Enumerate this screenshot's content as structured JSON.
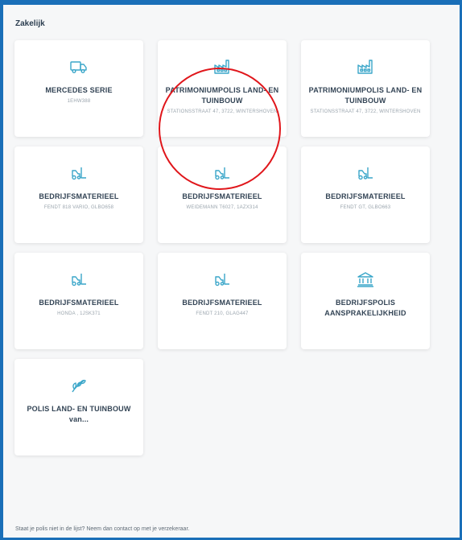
{
  "section": {
    "title": "Zakelijk"
  },
  "colors": {
    "accent": "#1a6fb8",
    "icon": "#3aa6c9",
    "highlight": "#e0161b"
  },
  "cards": [
    {
      "icon": "truck-icon",
      "title": "MERCEDES SERIE",
      "subtitle": "1EHW388"
    },
    {
      "icon": "factory-icon",
      "title": "PATRIMONIUMPOLIS LAND- EN TUINBOUW",
      "subtitle": "STATIONSSTRAAT 47, 3722, WINTERSHOVEN"
    },
    {
      "icon": "factory-icon",
      "title": "PATRIMONIUMPOLIS LAND- EN TUINBOUW",
      "subtitle": "STATIONSSTRAAT 47, 3722, WINTERSHOVEN"
    },
    {
      "icon": "forklift-icon",
      "title": "BEDRIJFSMATERIEEL",
      "subtitle": "FENDT 818 VARIO, GLBO658"
    },
    {
      "icon": "forklift-icon",
      "title": "BEDRIJFSMATERIEEL",
      "subtitle": "WEIDEMANN T6027, 1AZX314"
    },
    {
      "icon": "forklift-icon",
      "title": "BEDRIJFSMATERIEEL",
      "subtitle": "FENDT GT, GLBO663"
    },
    {
      "icon": "forklift-icon",
      "title": "BEDRIJFSMATERIEEL",
      "subtitle": "HONDA , 1JSK371"
    },
    {
      "icon": "forklift-icon",
      "title": "BEDRIJFSMATERIEEL",
      "subtitle": "FENDT 210, GLAG447"
    },
    {
      "icon": "bank-icon",
      "title": "BEDRIJFSPOLIS AANSPRAKELIJKHEID",
      "subtitle": ""
    },
    {
      "icon": "leaf-icon",
      "title": "POLIS LAND- EN TUINBOUW van...",
      "subtitle": ""
    }
  ],
  "footer": {
    "note": "Staat je polis niet in de lijst? Neem dan contact op met je verzekeraar."
  }
}
